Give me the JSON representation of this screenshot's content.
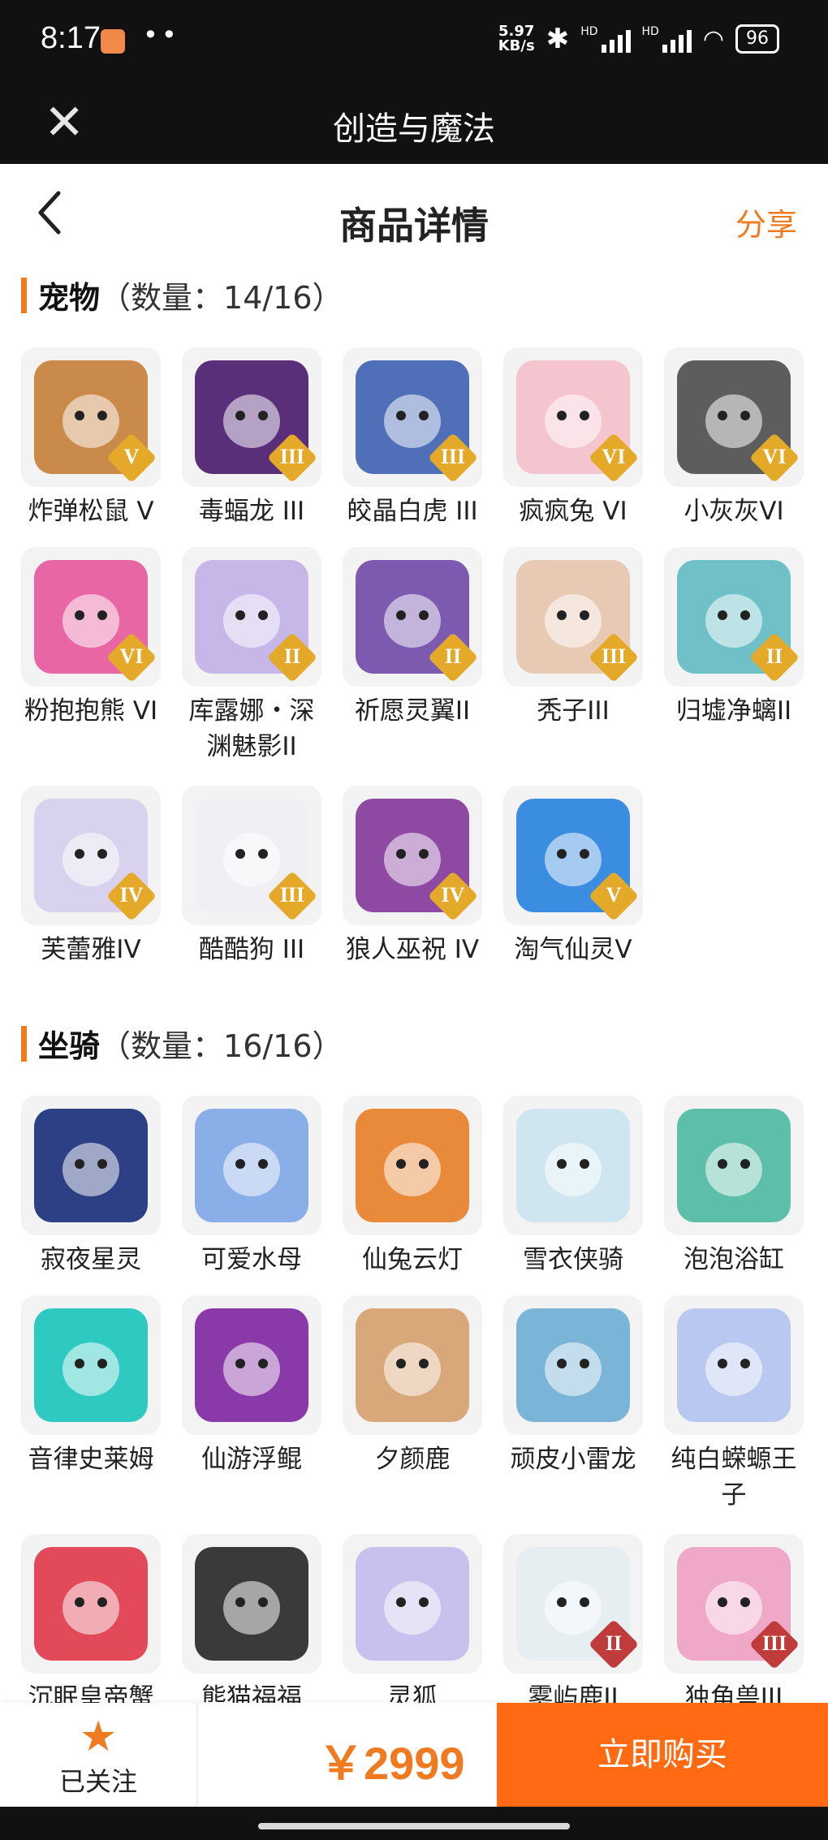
{
  "status": {
    "time": "8:17",
    "speed_value": "5.97",
    "speed_unit": "KB/s",
    "hd": "HD",
    "battery": "96"
  },
  "app_title": "创造与魔法",
  "page": {
    "title": "商品详情",
    "share": "分享"
  },
  "pets": {
    "name": "宠物",
    "count": "（数量：14/16）",
    "items": [
      {
        "label": "炸弹松鼠 V",
        "tier": "V",
        "color": "#c98a4a"
      },
      {
        "label": "毒蝠龙 III",
        "tier": "III",
        "color": "#5a2f7a"
      },
      {
        "label": "皎晶白虎 III",
        "tier": "III",
        "color": "#4f6fb8"
      },
      {
        "label": "疯疯兔 VI",
        "tier": "VI",
        "color": "#f4c4cf"
      },
      {
        "label": "小灰灰VI",
        "tier": "VI",
        "color": "#5d5d5d"
      },
      {
        "label": "粉抱抱熊 VI",
        "tier": "VI",
        "color": "#e866a3"
      },
      {
        "label": "库露娜・深渊魅影II",
        "tier": "II",
        "color": "#c7b6e8"
      },
      {
        "label": "祈愿灵翼II",
        "tier": "II",
        "color": "#7b5ab0"
      },
      {
        "label": "秃子III",
        "tier": "III",
        "color": "#e8c9b3"
      },
      {
        "label": "归墟净螭II",
        "tier": "II",
        "color": "#6fc1c7"
      },
      {
        "label": "芙蕾雅IV",
        "tier": "IV",
        "color": "#d9d2ee"
      },
      {
        "label": "酷酷狗 III",
        "tier": "III",
        "color": "#f0f0f4"
      },
      {
        "label": "狼人巫祝 IV",
        "tier": "IV",
        "color": "#8e4aa2"
      },
      {
        "label": "淘气仙灵V",
        "tier": "V",
        "color": "#3a8de0"
      }
    ]
  },
  "mounts": {
    "name": "坐骑",
    "count": "（数量：16/16）",
    "items": [
      {
        "label": "寂夜星灵",
        "tier": "",
        "color": "#2d3f85"
      },
      {
        "label": "可爱水母",
        "tier": "",
        "color": "#8aaee8"
      },
      {
        "label": "仙兔云灯",
        "tier": "",
        "color": "#e88a3a"
      },
      {
        "label": "雪衣侠骑",
        "tier": "",
        "color": "#cfe6f0"
      },
      {
        "label": "泡泡浴缸",
        "tier": "",
        "color": "#5dbfa9"
      },
      {
        "label": "音律史莱姆",
        "tier": "",
        "color": "#2ec9c0"
      },
      {
        "label": "仙游浮鲲",
        "tier": "",
        "color": "#8a3aa8"
      },
      {
        "label": "夕颜鹿",
        "tier": "",
        "color": "#d9a87a"
      },
      {
        "label": "顽皮小雷龙",
        "tier": "",
        "color": "#7ab4d6"
      },
      {
        "label": "纯白蝾螈王子",
        "tier": "",
        "color": "#b8c8f0"
      },
      {
        "label": "沉眠皇帝蟹",
        "tier": "",
        "color": "#e24a5a"
      },
      {
        "label": "熊猫福福",
        "tier": "",
        "color": "#3a3a3a"
      },
      {
        "label": "灵狐",
        "tier": "",
        "color": "#c9c0ee"
      },
      {
        "label": "雾屿鹿II",
        "tier": "II",
        "color": "#e6eef2"
      },
      {
        "label": "独角兽III",
        "tier": "III",
        "color": "#f0a8c8"
      }
    ]
  },
  "bottom": {
    "follow_label": "已关注",
    "price": "￥2999",
    "buy_label": "立即购买"
  },
  "colors": {
    "accent": "#f07a1f",
    "buy_button": "#ff6a13",
    "tier_gold": "#e5a92a",
    "tier_red": "#c03b3b"
  }
}
